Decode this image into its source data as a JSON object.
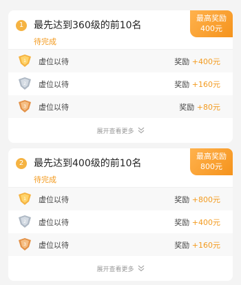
{
  "colors": {
    "accent": "#f39a1e",
    "gold": "#f5b342",
    "silver": "#b9c3cf",
    "bronze": "#e9a15a"
  },
  "tasks": [
    {
      "index": "1",
      "title": "最先达到360级的前10名",
      "status": "待完成",
      "max_reward_label": "最高奖励",
      "max_reward_value": "400元",
      "rows": [
        {
          "medal": "gold-medal",
          "rank_label": "1",
          "name": "虚位以待",
          "reward_label": "奖励",
          "amount": "+400元"
        },
        {
          "medal": "silver-medal",
          "rank_label": "2",
          "name": "虚位以待",
          "reward_label": "奖励",
          "amount": "+160元"
        },
        {
          "medal": "bronze-medal",
          "rank_label": "3",
          "name": "虚位以待",
          "reward_label": "奖励",
          "amount": "+80元"
        }
      ],
      "more_label": "展开查看更多"
    },
    {
      "index": "2",
      "title": "最先达到400级的前10名",
      "status": "待完成",
      "max_reward_label": "最高奖励",
      "max_reward_value": "800元",
      "rows": [
        {
          "medal": "gold-medal",
          "rank_label": "1",
          "name": "虚位以待",
          "reward_label": "奖励",
          "amount": "+800元"
        },
        {
          "medal": "silver-medal",
          "rank_label": "2",
          "name": "虚位以待",
          "reward_label": "奖励",
          "amount": "+400元"
        },
        {
          "medal": "bronze-medal",
          "rank_label": "3",
          "name": "虚位以待",
          "reward_label": "奖励",
          "amount": "+160元"
        }
      ],
      "more_label": "展开查看更多"
    }
  ]
}
